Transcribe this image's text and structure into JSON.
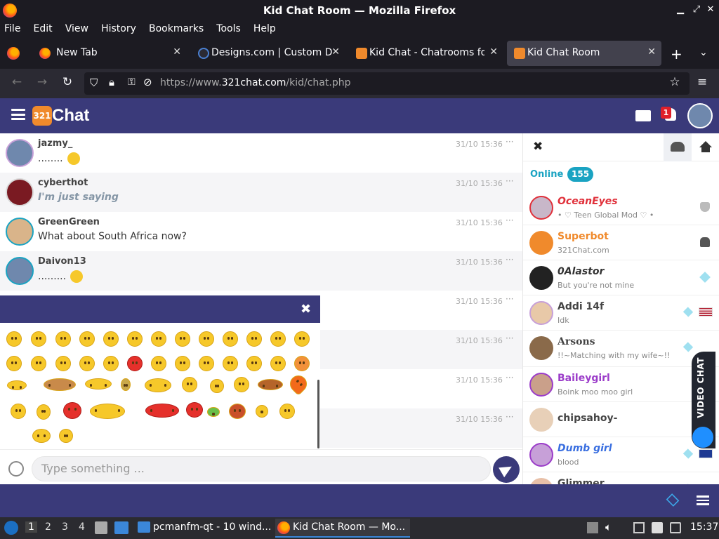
{
  "window": {
    "title": "Kid Chat Room — Mozilla Firefox"
  },
  "menubar": [
    "File",
    "Edit",
    "View",
    "History",
    "Bookmarks",
    "Tools",
    "Help"
  ],
  "tabs": [
    {
      "label": "New Tab",
      "active": false
    },
    {
      "label": "Designs.com | Custom Do",
      "active": false
    },
    {
      "label": "Kid Chat - Chatrooms for",
      "active": false
    },
    {
      "label": "Kid Chat Room",
      "active": true
    }
  ],
  "url": {
    "prefix": "https://www.",
    "domain": "321chat.com",
    "path": "/kid/chat.php"
  },
  "site": {
    "logo_badge": "321",
    "logo_text": "Chat",
    "notification_count": "1",
    "colors": {
      "primary": "#3a3a7a",
      "accent": "#1aa3c2",
      "orange": "#f08a2c"
    }
  },
  "messages": [
    {
      "user": "jazmy_",
      "text": "........",
      "time": "31/10 15:36",
      "emoji": true,
      "style": "normal"
    },
    {
      "user": "cyberthot",
      "text": "I'm just saying",
      "time": "31/10 15:36",
      "emoji": false,
      "style": "italic"
    },
    {
      "user": "GreenGreen",
      "text": "What about South Africa now?",
      "time": "31/10 15:36",
      "emoji": false,
      "style": "normal"
    },
    {
      "user": "Daivon13",
      "text": ".........",
      "time": "31/10 15:36",
      "emoji": true,
      "style": "normal"
    },
    {
      "user": "",
      "text": "",
      "time": "31/10 15:36",
      "emoji": false,
      "style": "normal"
    },
    {
      "user": "",
      "text": "",
      "time": "31/10 15:36",
      "emoji": false,
      "style": "normal"
    },
    {
      "user": "",
      "text": "",
      "time": "31/10 15:36",
      "emoji": false,
      "style": "normal"
    },
    {
      "user": "",
      "text": "",
      "time": "31/10 15:36",
      "emoji": false,
      "style": "normal"
    }
  ],
  "input": {
    "placeholder": "Type something ..."
  },
  "sidebar": {
    "online_label": "Online",
    "online_count": "155",
    "users": [
      {
        "name": "OceanEyes",
        "status": "• ♡ Teen Global Mod ♡ •",
        "color": "#e0303a",
        "badge": "shield",
        "flag": ""
      },
      {
        "name": "Superbot",
        "status": "321Chat.com",
        "color": "#f08a2c",
        "badge": "android",
        "flag": ""
      },
      {
        "name": "0Alastor",
        "status": "But you're not mine",
        "color": "#333333",
        "badge": "diamond",
        "flag": ""
      },
      {
        "name": "Addi 14f",
        "status": "Idk",
        "color": "#444444",
        "badge": "diamond",
        "flag": "US"
      },
      {
        "name": "Arsons",
        "status": "!!~Matching with my wife~!!",
        "color": "#444444",
        "badge": "diamond",
        "flag": "US"
      },
      {
        "name": "Baileygirl",
        "status": "Boink moo moo girl",
        "color": "#9b3cc9",
        "badge": "",
        "flag": ""
      },
      {
        "name": "chipsahoy-",
        "status": "",
        "color": "#444444",
        "badge": "",
        "flag": ""
      },
      {
        "name": "Dumb girl",
        "status": "blood",
        "color": "#3a6fe0",
        "badge": "diamond",
        "flag": "GB"
      },
      {
        "name": "Glimmer",
        "status": "",
        "color": "#444444",
        "badge": "diamond",
        "flag": "US"
      }
    ]
  },
  "video_chat": {
    "label": "VIDEO CHAT"
  },
  "taskbar": {
    "workspaces": [
      "1",
      "2",
      "3",
      "4"
    ],
    "items": [
      {
        "label": "pcmanfm-qt - 10 wind...",
        "active": false
      },
      {
        "label": "Kid Chat Room — Mo...",
        "active": true
      }
    ],
    "clock": "15:37"
  }
}
